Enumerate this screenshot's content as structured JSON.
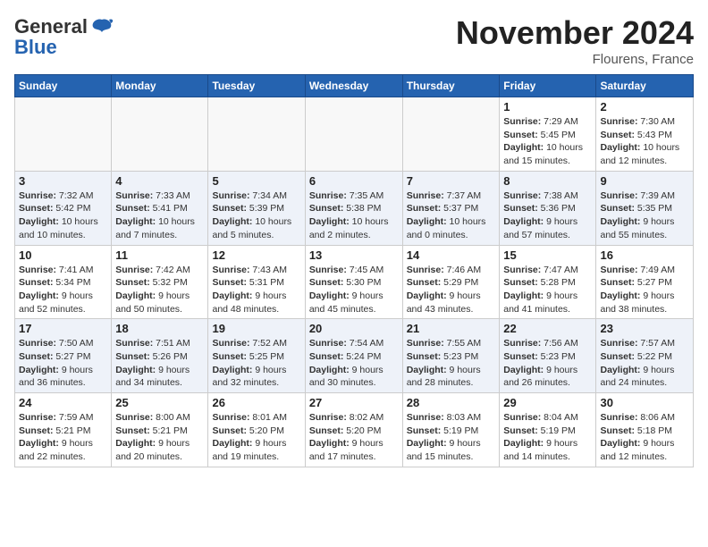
{
  "logo": {
    "general": "General",
    "blue": "Blue"
  },
  "header": {
    "month": "November 2024",
    "location": "Flourens, France"
  },
  "weekdays": [
    "Sunday",
    "Monday",
    "Tuesday",
    "Wednesday",
    "Thursday",
    "Friday",
    "Saturday"
  ],
  "weeks": [
    [
      {
        "day": "",
        "info": ""
      },
      {
        "day": "",
        "info": ""
      },
      {
        "day": "",
        "info": ""
      },
      {
        "day": "",
        "info": ""
      },
      {
        "day": "",
        "info": ""
      },
      {
        "day": "1",
        "info": "Sunrise: 7:29 AM\nSunset: 5:45 PM\nDaylight: 10 hours and 15 minutes."
      },
      {
        "day": "2",
        "info": "Sunrise: 7:30 AM\nSunset: 5:43 PM\nDaylight: 10 hours and 12 minutes."
      }
    ],
    [
      {
        "day": "3",
        "info": "Sunrise: 7:32 AM\nSunset: 5:42 PM\nDaylight: 10 hours and 10 minutes."
      },
      {
        "day": "4",
        "info": "Sunrise: 7:33 AM\nSunset: 5:41 PM\nDaylight: 10 hours and 7 minutes."
      },
      {
        "day": "5",
        "info": "Sunrise: 7:34 AM\nSunset: 5:39 PM\nDaylight: 10 hours and 5 minutes."
      },
      {
        "day": "6",
        "info": "Sunrise: 7:35 AM\nSunset: 5:38 PM\nDaylight: 10 hours and 2 minutes."
      },
      {
        "day": "7",
        "info": "Sunrise: 7:37 AM\nSunset: 5:37 PM\nDaylight: 10 hours and 0 minutes."
      },
      {
        "day": "8",
        "info": "Sunrise: 7:38 AM\nSunset: 5:36 PM\nDaylight: 9 hours and 57 minutes."
      },
      {
        "day": "9",
        "info": "Sunrise: 7:39 AM\nSunset: 5:35 PM\nDaylight: 9 hours and 55 minutes."
      }
    ],
    [
      {
        "day": "10",
        "info": "Sunrise: 7:41 AM\nSunset: 5:34 PM\nDaylight: 9 hours and 52 minutes."
      },
      {
        "day": "11",
        "info": "Sunrise: 7:42 AM\nSunset: 5:32 PM\nDaylight: 9 hours and 50 minutes."
      },
      {
        "day": "12",
        "info": "Sunrise: 7:43 AM\nSunset: 5:31 PM\nDaylight: 9 hours and 48 minutes."
      },
      {
        "day": "13",
        "info": "Sunrise: 7:45 AM\nSunset: 5:30 PM\nDaylight: 9 hours and 45 minutes."
      },
      {
        "day": "14",
        "info": "Sunrise: 7:46 AM\nSunset: 5:29 PM\nDaylight: 9 hours and 43 minutes."
      },
      {
        "day": "15",
        "info": "Sunrise: 7:47 AM\nSunset: 5:28 PM\nDaylight: 9 hours and 41 minutes."
      },
      {
        "day": "16",
        "info": "Sunrise: 7:49 AM\nSunset: 5:27 PM\nDaylight: 9 hours and 38 minutes."
      }
    ],
    [
      {
        "day": "17",
        "info": "Sunrise: 7:50 AM\nSunset: 5:27 PM\nDaylight: 9 hours and 36 minutes."
      },
      {
        "day": "18",
        "info": "Sunrise: 7:51 AM\nSunset: 5:26 PM\nDaylight: 9 hours and 34 minutes."
      },
      {
        "day": "19",
        "info": "Sunrise: 7:52 AM\nSunset: 5:25 PM\nDaylight: 9 hours and 32 minutes."
      },
      {
        "day": "20",
        "info": "Sunrise: 7:54 AM\nSunset: 5:24 PM\nDaylight: 9 hours and 30 minutes."
      },
      {
        "day": "21",
        "info": "Sunrise: 7:55 AM\nSunset: 5:23 PM\nDaylight: 9 hours and 28 minutes."
      },
      {
        "day": "22",
        "info": "Sunrise: 7:56 AM\nSunset: 5:23 PM\nDaylight: 9 hours and 26 minutes."
      },
      {
        "day": "23",
        "info": "Sunrise: 7:57 AM\nSunset: 5:22 PM\nDaylight: 9 hours and 24 minutes."
      }
    ],
    [
      {
        "day": "24",
        "info": "Sunrise: 7:59 AM\nSunset: 5:21 PM\nDaylight: 9 hours and 22 minutes."
      },
      {
        "day": "25",
        "info": "Sunrise: 8:00 AM\nSunset: 5:21 PM\nDaylight: 9 hours and 20 minutes."
      },
      {
        "day": "26",
        "info": "Sunrise: 8:01 AM\nSunset: 5:20 PM\nDaylight: 9 hours and 19 minutes."
      },
      {
        "day": "27",
        "info": "Sunrise: 8:02 AM\nSunset: 5:20 PM\nDaylight: 9 hours and 17 minutes."
      },
      {
        "day": "28",
        "info": "Sunrise: 8:03 AM\nSunset: 5:19 PM\nDaylight: 9 hours and 15 minutes."
      },
      {
        "day": "29",
        "info": "Sunrise: 8:04 AM\nSunset: 5:19 PM\nDaylight: 9 hours and 14 minutes."
      },
      {
        "day": "30",
        "info": "Sunrise: 8:06 AM\nSunset: 5:18 PM\nDaylight: 9 hours and 12 minutes."
      }
    ]
  ]
}
